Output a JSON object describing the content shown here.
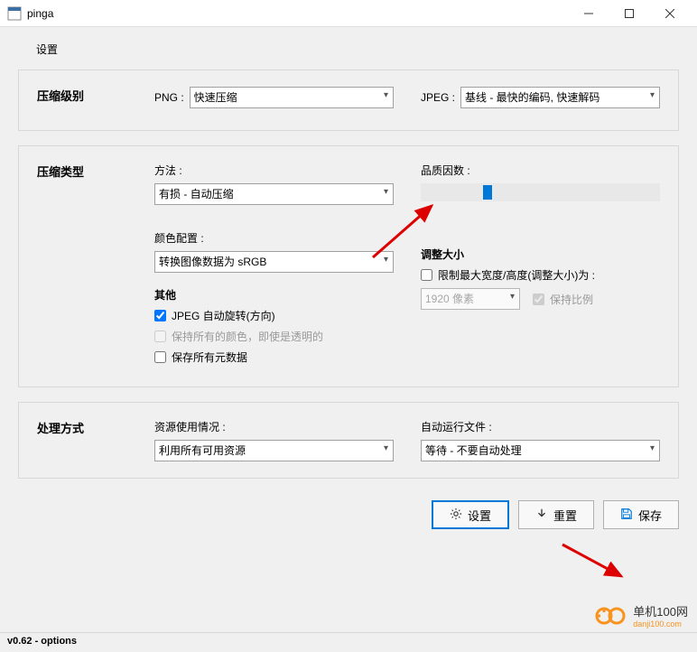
{
  "window": {
    "title": "pinga"
  },
  "page": {
    "title": "设置"
  },
  "compressionLevel": {
    "heading": "压缩级别",
    "pngLabel": "PNG :",
    "pngValue": "快速压缩",
    "jpegLabel": "JPEG :",
    "jpegValue": "基线 - 最快的编码, 快速解码"
  },
  "compressionType": {
    "heading": "压缩类型",
    "methodLabel": "方法 :",
    "methodValue": "有损 - 自动压缩",
    "colorLabel": "颜色配置 :",
    "colorValue": "转换图像数据为 sRGB",
    "otherHeading": "其他",
    "jpegAuto": "JPEG 自动旋转(方向)",
    "preserveColors": "保持所有的颜色，即使是透明的",
    "preserveMeta": "保存所有元数据",
    "qualityLabel": "品质因数 :",
    "resizeHeading": "调整大小",
    "limitMax": "限制最大宽度/高度(调整大小)为 :",
    "pixelsValue": "1920 像素",
    "keepRatio": "保持比例"
  },
  "processing": {
    "heading": "处理方式",
    "resourceLabel": "资源使用情况 :",
    "resourceValue": "利用所有可用资源",
    "autoLabel": "自动运行文件 :",
    "autoValue": "等待 - 不要自动处理"
  },
  "buttons": {
    "settings": "设置",
    "reset": "重置",
    "save": "保存"
  },
  "status": "v0.62 - options",
  "watermark": {
    "name": "单机100网",
    "url": "danji100.com"
  }
}
